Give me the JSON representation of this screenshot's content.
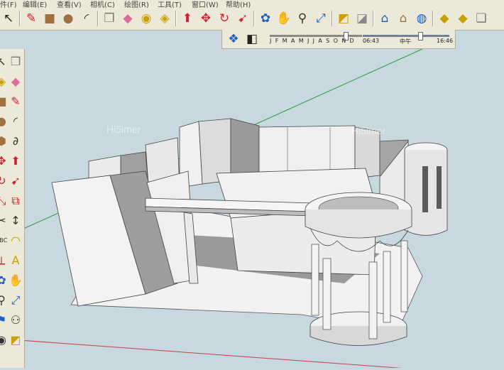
{
  "menu": {
    "items": [
      "件(F)",
      "编辑(E)",
      "查看(V)",
      "相机(C)",
      "绘图(R)",
      "工具(T)",
      "窗口(W)",
      "帮助(H)"
    ]
  },
  "toolbar": {
    "tools": [
      {
        "name": "select-arrow-icon",
        "glyph": "↖",
        "color": "#222"
      },
      {
        "name": "pencil-icon",
        "glyph": "✎",
        "color": "#c23"
      },
      {
        "name": "rectangle-icon",
        "glyph": "■",
        "color": "#a07040"
      },
      {
        "name": "circle-icon",
        "glyph": "●",
        "color": "#a07040"
      },
      {
        "name": "arc-icon",
        "glyph": "◜",
        "color": "#333"
      },
      {
        "name": "make-component-icon",
        "glyph": "❒",
        "color": "#777"
      },
      {
        "name": "eraser-icon",
        "glyph": "◆",
        "color": "#e06a9a"
      },
      {
        "name": "tape-measure-icon",
        "glyph": "◉",
        "color": "#c9a000"
      },
      {
        "name": "paint-bucket-icon",
        "glyph": "◈",
        "color": "#c9a000"
      },
      {
        "name": "push-pull-icon",
        "glyph": "⬆",
        "color": "#c23"
      },
      {
        "name": "move-icon",
        "glyph": "✥",
        "color": "#c23"
      },
      {
        "name": "rotate-icon",
        "glyph": "↻",
        "color": "#c23"
      },
      {
        "name": "follow-me-icon",
        "glyph": "➹",
        "color": "#c23"
      },
      {
        "name": "orbit-icon",
        "glyph": "✿",
        "color": "#2060c0"
      },
      {
        "name": "pan-icon",
        "glyph": "✋",
        "color": "#333"
      },
      {
        "name": "zoom-icon",
        "glyph": "⚲",
        "color": "#333"
      },
      {
        "name": "zoom-extents-icon",
        "glyph": "⤢",
        "color": "#2060c0"
      },
      {
        "name": "section-plane-icon",
        "glyph": "◩",
        "color": "#c9a000"
      },
      {
        "name": "section-display-icon",
        "glyph": "◪",
        "color": "#888"
      },
      {
        "name": "get-models-icon",
        "glyph": "⌂",
        "color": "#2060c0"
      },
      {
        "name": "share-model-icon",
        "glyph": "⌂",
        "color": "#a07040"
      },
      {
        "name": "google-earth-icon",
        "glyph": "◍",
        "color": "#2060c0"
      },
      {
        "name": "components-icon",
        "glyph": "◆",
        "color": "#c9a000"
      },
      {
        "name": "materials-icon",
        "glyph": "◆",
        "color": "#c9a000"
      },
      {
        "name": "3d-warehouse-icon",
        "glyph": "❏",
        "color": "#777"
      }
    ]
  },
  "shadow_toolbar": {
    "months": "J F M A M J J A S O N D",
    "time_start": "06:43",
    "noon": "中午",
    "time_end": "16:46"
  },
  "left_toolbar": {
    "tools": [
      {
        "name": "select-icon",
        "glyph": "↖",
        "color": "#222"
      },
      {
        "name": "component-icon",
        "glyph": "❒",
        "color": "#777"
      },
      {
        "name": "paint-icon",
        "glyph": "◈",
        "color": "#c9a000"
      },
      {
        "name": "eraser-icon",
        "glyph": "◆",
        "color": "#e06a9a"
      },
      {
        "name": "rectangle-icon",
        "glyph": "■",
        "color": "#a07040"
      },
      {
        "name": "line-icon",
        "glyph": "✎",
        "color": "#c23"
      },
      {
        "name": "circle-icon",
        "glyph": "●",
        "color": "#a07040"
      },
      {
        "name": "arc-icon",
        "glyph": "◜",
        "color": "#333"
      },
      {
        "name": "polygon-icon",
        "glyph": "⬢",
        "color": "#a07040"
      },
      {
        "name": "freehand-icon",
        "glyph": "∂",
        "color": "#333"
      },
      {
        "name": "move-icon",
        "glyph": "✥",
        "color": "#c23"
      },
      {
        "name": "push-pull-icon",
        "glyph": "⬆",
        "color": "#c23"
      },
      {
        "name": "rotate-icon",
        "glyph": "↻",
        "color": "#c23"
      },
      {
        "name": "follow-me-icon",
        "glyph": "➹",
        "color": "#c23"
      },
      {
        "name": "scale-icon",
        "glyph": "⤡",
        "color": "#c23"
      },
      {
        "name": "offset-icon",
        "glyph": "⧉",
        "color": "#c23"
      },
      {
        "name": "tape-measure-icon",
        "glyph": "✂",
        "color": "#333"
      },
      {
        "name": "dimension-icon",
        "glyph": "↕",
        "color": "#333"
      },
      {
        "name": "text-label-icon",
        "glyph": "ABC",
        "color": "#333"
      },
      {
        "name": "protractor-icon",
        "glyph": "◠",
        "color": "#c9a000"
      },
      {
        "name": "axes-icon",
        "glyph": "⟂",
        "color": "#c23"
      },
      {
        "name": "3d-text-icon",
        "glyph": "A",
        "color": "#c9a000"
      },
      {
        "name": "orbit-icon",
        "glyph": "✿",
        "color": "#2060c0"
      },
      {
        "name": "pan-icon",
        "glyph": "✋",
        "color": "#333"
      },
      {
        "name": "zoom-icon",
        "glyph": "⚲",
        "color": "#333"
      },
      {
        "name": "zoom-window-icon",
        "glyph": "⤢",
        "color": "#2060c0"
      },
      {
        "name": "position-camera-icon",
        "glyph": "⚑",
        "color": "#2060c0"
      },
      {
        "name": "walk-icon",
        "glyph": "⚇",
        "color": "#333"
      },
      {
        "name": "look-around-icon",
        "glyph": "◉",
        "color": "#333"
      },
      {
        "name": "section-icon",
        "glyph": "◩",
        "color": "#c9a000"
      }
    ]
  },
  "viewport": {
    "watermark": "Hi5imer",
    "background": "#c8d8e0",
    "axis_green": "#2e9e2e",
    "axis_red": "#c84040"
  }
}
